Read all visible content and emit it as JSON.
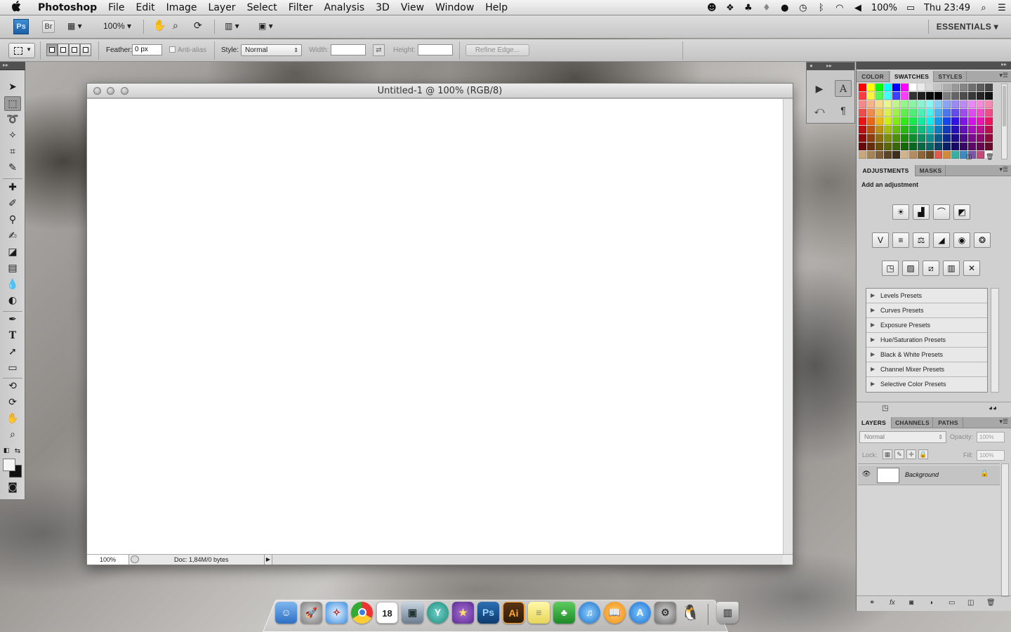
{
  "menubar": {
    "app_name": "Photoshop",
    "items": [
      "File",
      "Edit",
      "Image",
      "Layer",
      "Select",
      "Filter",
      "Analysis",
      "3D",
      "View",
      "Window",
      "Help"
    ],
    "battery": "100%",
    "clock": "Thu 23:49"
  },
  "appbar": {
    "logo": "Ps",
    "bridge": "Br",
    "zoom": "100%",
    "workspace": "ESSENTIALS ▾"
  },
  "options": {
    "feather_label": "Feather:",
    "feather_value": "0 px",
    "antialias_label": "Anti-alias",
    "style_label": "Style:",
    "style_value": "Normal",
    "width_label": "Width:",
    "height_label": "Height:",
    "refine_edge": "Refine Edge..."
  },
  "document": {
    "title": "Untitled-1 @ 100% (RGB/8)",
    "zoom": "100%",
    "doc_info": "Doc: 1,84M/0 bytes"
  },
  "swatch_panel": {
    "tabs": [
      "COLOR",
      "SWATCHES",
      "STYLES"
    ],
    "active_tab": "SWATCHES",
    "colors": {
      "row1": [
        "#ff0000",
        "#ffff00",
        "#00ff00",
        "#00ffff",
        "#0000ff",
        "#ff00ff",
        "#ffffff",
        "#ebebeb",
        "#d6d6d6",
        "#c2c2c2",
        "#adadad",
        "#999999",
        "#858585",
        "#707070",
        "#5c5c5c",
        "#474747"
      ],
      "row2": [
        "#ff3f3f",
        "#fff23f",
        "#4fff4f",
        "#3fffff",
        "#3f3fff",
        "#ff3fff",
        "#333333",
        "#1f1f1f",
        "#0a0a0a",
        "#000000",
        "#7d7d7d",
        "#666666",
        "#4d4d4d",
        "#383838",
        "#242424",
        "#101010"
      ]
    }
  },
  "adjustments": {
    "tabs": [
      "ADJUSTMENTS",
      "MASKS"
    ],
    "active_tab": "ADJUSTMENTS",
    "title": "Add an adjustment",
    "presets": [
      "Levels Presets",
      "Curves Presets",
      "Exposure Presets",
      "Hue/Saturation Presets",
      "Black & White Presets",
      "Channel Mixer Presets",
      "Selective Color Presets"
    ]
  },
  "layers": {
    "tabs": [
      "LAYERS",
      "CHANNELS",
      "PATHS"
    ],
    "active_tab": "LAYERS",
    "blend_mode": "Normal",
    "opacity_label": "Opacity:",
    "opacity_value": "100%",
    "lock_label": "Lock:",
    "fill_label": "Fill:",
    "fill_value": "100%",
    "items": [
      {
        "name": "Background",
        "visible": true,
        "locked": true
      }
    ]
  },
  "dock": {
    "apps": [
      "finder-icon",
      "launchpad-icon",
      "safari-icon",
      "chrome-icon",
      "calendar-icon",
      "preview-icon",
      "yammer-icon",
      "imovie-icon",
      "photoshop-icon",
      "illustrator-icon",
      "stickies-icon",
      "evernote-icon",
      "itunes-icon",
      "ibooks-icon",
      "app-store-icon",
      "system-preferences-icon",
      "adium-icon",
      "trash-icon"
    ],
    "calendar_day": "18",
    "ps_label": "Ps",
    "ai_label": "Ai"
  }
}
